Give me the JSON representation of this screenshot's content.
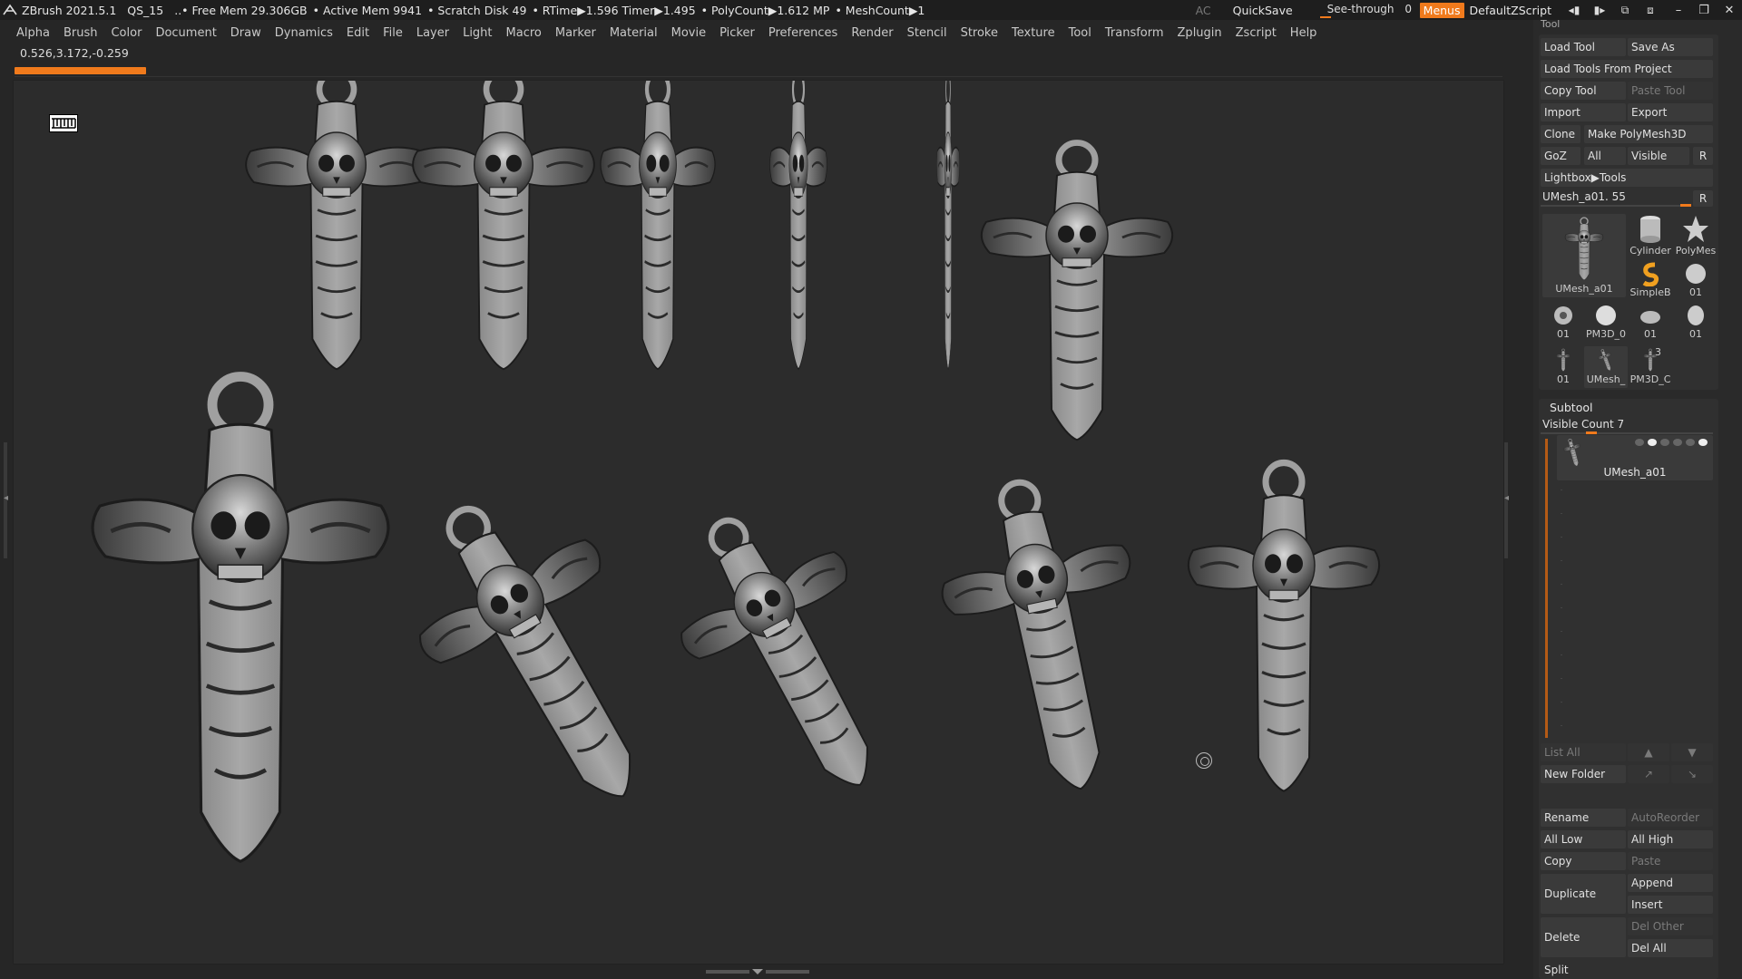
{
  "titlebar": {
    "app": "ZBrush 2021.5.1",
    "doc": "QS_15",
    "free_mem": "..• Free Mem 29.306GB",
    "active_mem": "• Active Mem 9941",
    "scratch": "• Scratch Disk 49",
    "rtime": "• RTime▶1.596 Timer▶1.495",
    "polycount": "• PolyCount▶1.612 MP",
    "meshcount": "• MeshCount▶1",
    "ac": "AC",
    "quicksave": "QuickSave",
    "see_through_label": "See-through",
    "see_through_value": "0",
    "menus": "Menus",
    "default_script": "DefaultZScript"
  },
  "menubar": [
    "Alpha",
    "Brush",
    "Color",
    "Document",
    "Draw",
    "Dynamics",
    "Edit",
    "File",
    "Layer",
    "Light",
    "Macro",
    "Marker",
    "Material",
    "Movie",
    "Picker",
    "Preferences",
    "Render",
    "Stencil",
    "Stroke",
    "Texture",
    "Tool",
    "Transform",
    "Zplugin",
    "Zscript",
    "Help"
  ],
  "coords": "0.526,3.172,-0.259",
  "palette": {
    "title": "Tool",
    "load_tool": "Load Tool",
    "save_as": "Save As",
    "load_tools_from_project": "Load Tools From Project",
    "copy_tool": "Copy Tool",
    "paste_tool": "Paste Tool",
    "import": "Import",
    "export": "Export",
    "clone": "Clone",
    "make_polymesh": "Make PolyMesh3D",
    "goz": "GoZ",
    "all": "All",
    "visible": "Visible",
    "r": "R",
    "lightbox_tools": "Lightbox▶Tools",
    "umesh_slider": "UMesh_a01. 55",
    "thumbs": [
      {
        "label": "UMesh_a01"
      },
      {
        "label": "Cylinder"
      },
      {
        "label": "PolyMes"
      },
      {
        "label": "SimpleB"
      },
      {
        "label": "01"
      },
      {
        "label": "01"
      },
      {
        "label": "PM3D_0"
      },
      {
        "label": "01"
      },
      {
        "label": "01"
      },
      {
        "label": "01"
      },
      {
        "label": "UMesh_"
      },
      {
        "label": "PM3D_C"
      },
      {
        "label": "3"
      }
    ],
    "subtool": "Subtool",
    "visible_count": "Visible Count 7",
    "subtool_item": "UMesh_a01",
    "list_all": "List All",
    "new_folder": "New Folder",
    "rename": "Rename",
    "autoreorder": "AutoReorder",
    "all_low": "All Low",
    "all_high": "All High",
    "copy": "Copy",
    "paste": "Paste",
    "duplicate": "Duplicate",
    "append": "Append",
    "insert": "Insert",
    "delete": "Delete",
    "del_other": "Del Other",
    "del_all": "Del All",
    "split": "Split"
  },
  "colors": {
    "accent": "#f07a1c",
    "bg": "#262626",
    "viewport": "#2c2c2c"
  }
}
